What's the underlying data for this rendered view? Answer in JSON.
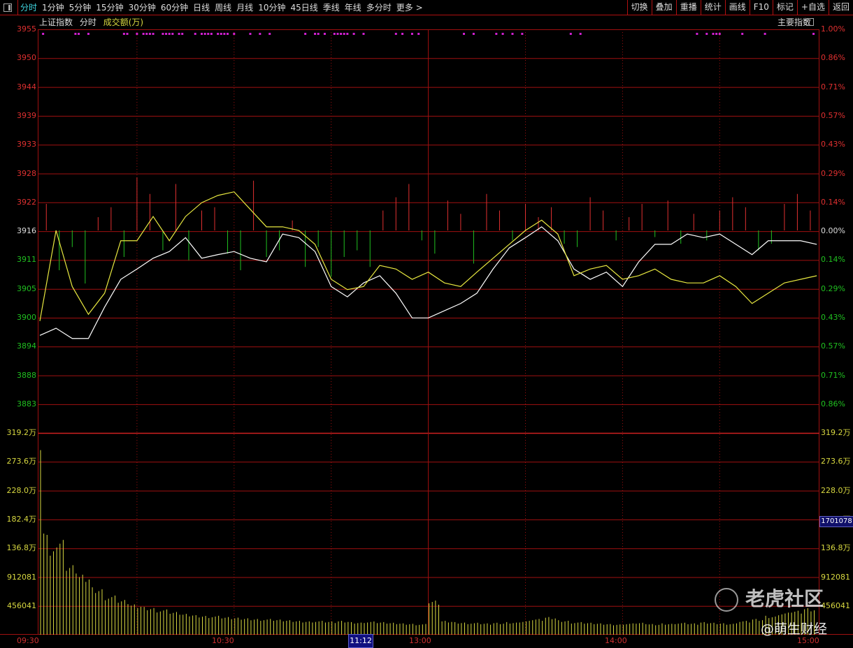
{
  "toolbar": {
    "periods": [
      "分时",
      "1分钟",
      "5分钟",
      "15分钟",
      "30分钟",
      "60分钟",
      "日线",
      "周线",
      "月线",
      "10分钟",
      "45日线",
      "季线",
      "年线",
      "多分时",
      "更多 >"
    ],
    "active_index": 0,
    "actions": [
      "切换",
      "叠加",
      "重播",
      "统计",
      "画线",
      "F10",
      "标记",
      "+自选",
      "返回"
    ]
  },
  "header": {
    "index_name": "上证指数",
    "mode": "分时",
    "volume_label": "成交额(万)",
    "index_menu": "主要指数"
  },
  "colors": {
    "up": "#e03030",
    "down": "#20c020",
    "price_line": "#ffffff",
    "avg_line": "#e8e840",
    "volume": "#d8d840",
    "grid": "#a01010",
    "dots": "#d020d0"
  },
  "price_axis": {
    "left": [
      "3955",
      "3950",
      "3944",
      "3939",
      "3933",
      "3928",
      "3922",
      "3916",
      "3911",
      "3905",
      "3900",
      "3894",
      "3888",
      "3883"
    ],
    "right": [
      "1.00%",
      "0.86%",
      "0.71%",
      "0.57%",
      "0.43%",
      "0.29%",
      "0.14%",
      "0.00%",
      "0.14%",
      "0.29%",
      "0.43%",
      "0.57%",
      "0.71%",
      "0.86%"
    ]
  },
  "volume_axis": {
    "labels": [
      "319.2万",
      "273.6万",
      "228.0万",
      "182.4万",
      "136.8万",
      "912081",
      "456041"
    ],
    "current_value": "1701078"
  },
  "time_axis": {
    "labels": [
      "09:30",
      "10:30",
      "13:00",
      "14:00",
      "15:00"
    ],
    "cursor": "11:12"
  },
  "watermark": {
    "brand": "老虎社区",
    "author": "@萌生财经"
  },
  "chart_data": {
    "type": "line",
    "title": "上证指数 分时",
    "base_price": 3916,
    "ylim": [
      3878,
      3955
    ],
    "x_minutes_step": 5,
    "series": [
      {
        "name": "price",
        "values": [
          3895.6,
          3897.0,
          3895.0,
          3895.0,
          3901.1,
          3906.5,
          3908.5,
          3910.6,
          3911.9,
          3914.6,
          3910.6,
          3911.3,
          3911.9,
          3910.6,
          3909.9,
          3915.3,
          3914.6,
          3911.9,
          3905.1,
          3903.1,
          3905.8,
          3907.2,
          3903.8,
          3899.0,
          3899.0,
          3900.4,
          3901.8,
          3903.8,
          3908.5,
          3912.6,
          3914.6,
          3916.7,
          3914.0,
          3908.5,
          3906.5,
          3907.9,
          3905.1,
          3909.9,
          3913.3,
          3913.3,
          3915.3,
          3914.6,
          3915.3,
          3913.3,
          3911.3,
          3914.0,
          3914.0,
          3914.0,
          3913.3
        ]
      },
      {
        "name": "average",
        "values": [
          3898.4,
          3916.0,
          3905.1,
          3899.7,
          3903.8,
          3914.0,
          3914.0,
          3918.7,
          3914.0,
          3918.7,
          3921.4,
          3922.8,
          3923.5,
          3920.1,
          3916.7,
          3916.7,
          3916.0,
          3913.3,
          3906.5,
          3904.5,
          3905.1,
          3909.2,
          3908.5,
          3906.5,
          3907.9,
          3905.8,
          3905.1,
          3907.9,
          3910.6,
          3913.3,
          3916.0,
          3918.0,
          3915.3,
          3907.2,
          3908.5,
          3909.2,
          3906.5,
          3907.2,
          3908.5,
          3906.5,
          3905.8,
          3905.8,
          3907.2,
          3905.1,
          3901.8,
          3903.8,
          3905.8,
          3906.5,
          3907.2
        ]
      }
    ],
    "breadth_step_minutes": 4,
    "breadth": [
      40,
      -60,
      -25,
      -80,
      20,
      35,
      -40,
      80,
      55,
      -30,
      70,
      -45,
      30,
      35,
      -35,
      -60,
      75,
      -40,
      -30,
      15,
      -55,
      -25,
      -70,
      -40,
      -30,
      -55,
      30,
      50,
      70,
      -15,
      -35,
      45,
      25,
      -50,
      55,
      30,
      -15,
      40,
      20,
      35,
      -20,
      -25,
      50,
      30,
      -15,
      20,
      40,
      -10,
      45,
      -20,
      25,
      -15,
      30,
      50,
      35,
      -30,
      -20,
      40,
      55,
      30
    ],
    "volume_step_minutes": 4,
    "volume_wan": [
      292,
      150,
      110,
      95,
      75,
      62,
      55,
      48,
      44,
      40,
      36,
      33,
      31,
      30,
      28,
      27,
      26,
      25,
      24,
      23,
      22,
      22,
      21,
      22,
      20,
      21,
      20,
      19,
      18,
      17,
      54,
      22,
      20,
      19,
      18,
      19,
      20,
      22,
      25,
      28,
      23,
      20,
      19,
      18,
      17,
      18,
      19,
      17,
      18,
      19,
      18,
      20,
      19,
      18,
      22,
      25,
      30,
      35,
      38,
      42
    ],
    "volume_ylim": [
      0,
      319.2
    ],
    "signal_minutes": [
      1,
      11,
      12,
      15,
      26,
      27,
      30,
      32,
      33,
      34,
      35,
      38,
      39,
      40,
      41,
      43,
      44,
      48,
      50,
      51,
      52,
      53,
      55,
      56,
      57,
      58,
      60,
      65,
      68,
      71,
      82,
      85,
      86,
      88,
      91,
      92,
      93,
      94,
      95,
      97,
      100,
      110,
      112,
      115,
      117,
      131,
      134,
      141,
      143,
      146,
      149,
      164,
      167,
      203,
      206,
      208,
      209,
      210,
      217,
      224,
      239
    ]
  }
}
